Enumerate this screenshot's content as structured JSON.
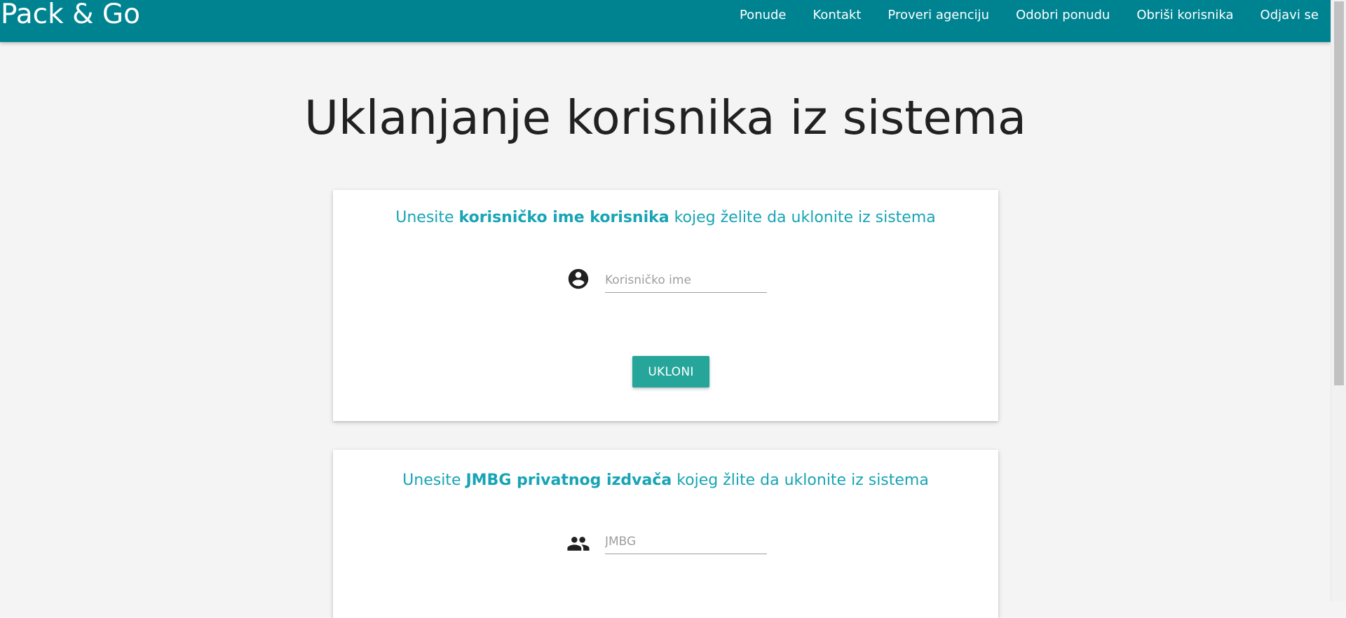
{
  "navbar": {
    "brand": "Pack & Go",
    "links": [
      "Ponude",
      "Kontakt",
      "Proveri agenciju",
      "Odobri ponudu",
      "Obriši korisnika",
      "Odjavi se"
    ],
    "color": "#008391"
  },
  "page": {
    "title": "Uklanjanje korisnika iz sistema"
  },
  "card_username": {
    "heading_prefix": "Unesite ",
    "heading_bold": "korisničko ime korisnika",
    "heading_suffix": " kojeg želite da uklonite iz sistema",
    "icon": "account-circle-icon",
    "placeholder": "Korisničko ime",
    "value": "",
    "button_label": "UKLONI"
  },
  "card_jmbg": {
    "heading_prefix": "Unesite ",
    "heading_bold": "JMBG privatnog izdvača",
    "heading_suffix": " kojeg žlite da uklonite iz sistema",
    "icon": "people-icon",
    "placeholder": "JMBG",
    "value": ""
  },
  "colors": {
    "heading_accent": "#17a4b5",
    "button": "#26a69a",
    "background": "#f4f4f4"
  }
}
